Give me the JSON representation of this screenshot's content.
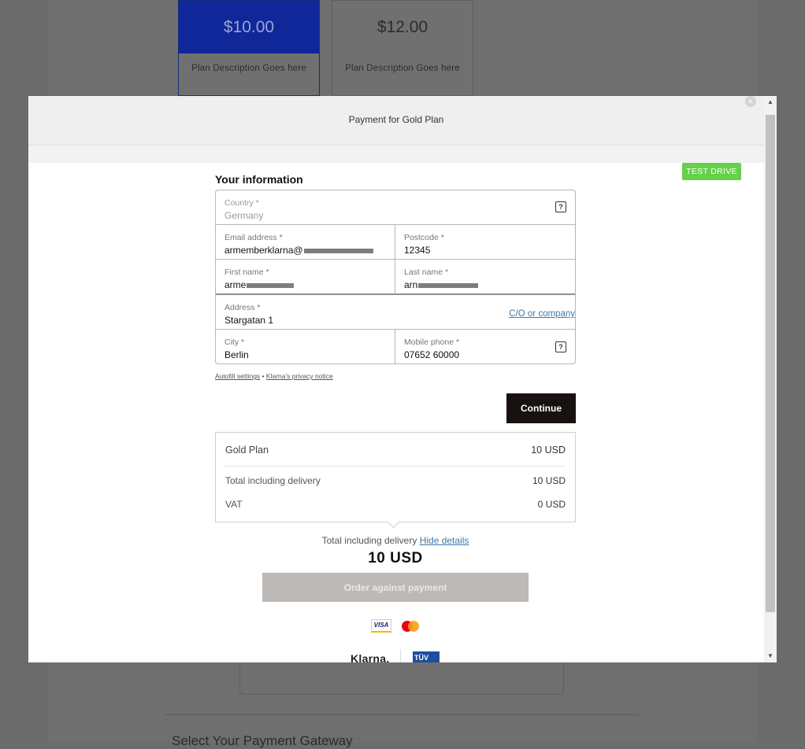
{
  "background": {
    "plans": [
      {
        "price": "$10.00",
        "description": "Plan Description Goes here",
        "selected": true
      },
      {
        "price": "$12.00",
        "description": "Plan Description Goes here",
        "selected": false
      }
    ],
    "section_title": "Select Your Payment Gateway"
  },
  "modal": {
    "title": "Payment for Gold Plan",
    "close_glyph": "×"
  },
  "badge": "TEST DRIVE",
  "form": {
    "section_title": "Your information",
    "country": {
      "label": "Country *",
      "value": "Germany"
    },
    "email": {
      "label": "Email address *",
      "value": "armemberklarna@"
    },
    "postcode": {
      "label": "Postcode *",
      "value": "12345"
    },
    "first_name": {
      "label": "First name *",
      "value": "arme"
    },
    "last_name": {
      "label": "Last name *",
      "value": "arn"
    },
    "address": {
      "label": "Address *",
      "value": "Stargatan 1",
      "link": "C/O or company"
    },
    "city": {
      "label": "City *",
      "value": "Berlin"
    },
    "phone": {
      "label": "Mobile phone *",
      "value": "07652 60000"
    },
    "help_glyph": "?"
  },
  "links": {
    "autofill": "Autofill settings",
    "separator": "•",
    "privacy": "Klarna's privacy notice"
  },
  "continue_label": "Continue",
  "summary": {
    "rows": [
      {
        "label": "Gold Plan",
        "amount": "10 USD"
      },
      {
        "label": "Total including delivery",
        "amount": "10 USD"
      },
      {
        "label": "VAT",
        "amount": "0 USD"
      }
    ]
  },
  "total": {
    "label": "Total including delivery",
    "toggle": "Hide details",
    "amount": "10 USD"
  },
  "order_label": "Order against payment",
  "footer": {
    "visa": "VISA",
    "klarna": "Klarna.",
    "tuv": "TÜV"
  },
  "colors": {
    "accent_blue": "#0f2799",
    "test_drive": "#63d14a",
    "continue_bg": "#17120f",
    "link": "#3f78a9"
  }
}
